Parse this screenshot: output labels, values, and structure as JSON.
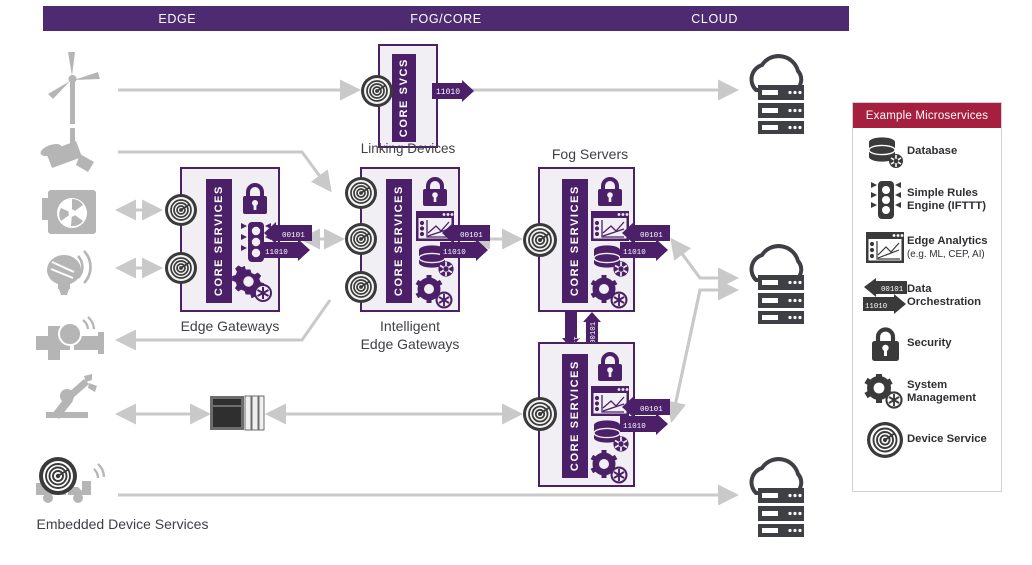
{
  "tiers": [
    {
      "label": "EDGE"
    },
    {
      "label": "FOG/CORE"
    },
    {
      "label": "CLOUD"
    }
  ],
  "colors": {
    "tier_bar": "#4e2a70",
    "box_border": "#4b2069",
    "box_fill": "#f1eff3",
    "core_bar": "#4b2069",
    "legend_header": "#a71f3e",
    "connector": "#c9c9c9",
    "device_icon": "#b0b0b0",
    "cloud_icon": "#3f3f46"
  },
  "boxes": {
    "linking_devices": {
      "caption": "Linking Devices",
      "core_label": "CORE SVCS",
      "device_services": 1,
      "microservices": []
    },
    "edge_gateways": {
      "caption": "Edge Gateways",
      "core_label": "CORE SERVICES",
      "device_services": 2,
      "microservices": [
        "security",
        "rules-engine",
        "system-management"
      ]
    },
    "intelligent_edge_gateways": {
      "caption_line1": "Intelligent",
      "caption_line2": "Edge Gateways",
      "core_label": "CORE SERVICES",
      "device_services": 3,
      "microservices": [
        "security",
        "edge-analytics",
        "database",
        "system-management"
      ]
    },
    "fog_servers": {
      "caption": "Fog Servers",
      "core_label": "CORE SERVICES",
      "device_services": 1,
      "microservices": [
        "security",
        "edge-analytics",
        "database",
        "system-management"
      ]
    },
    "fog_servers_lower": {
      "core_label": "CORE SERVICES",
      "device_services": 1,
      "microservices": [
        "security",
        "edge-analytics",
        "database",
        "system-management"
      ]
    }
  },
  "orchestration": {
    "inbound_bits": "00101",
    "outbound_bits": "11010",
    "top_bits": "11010",
    "up_bits": "00101",
    "down_bits": "11010"
  },
  "embedded_label": "Embedded Device Services",
  "devices": [
    {
      "name": "wind-turbine"
    },
    {
      "name": "security-camera"
    },
    {
      "name": "hvac-unit"
    },
    {
      "name": "smart-light"
    },
    {
      "name": "pipe-sensor"
    },
    {
      "name": "robotic-arm"
    },
    {
      "name": "connected-truck"
    },
    {
      "name": "plc-controller"
    }
  ],
  "clouds": [
    {
      "name": "cloud-server-top"
    },
    {
      "name": "cloud-server-middle"
    },
    {
      "name": "cloud-server-bottom"
    }
  ],
  "legend": {
    "title": "Example Microservices",
    "items": [
      {
        "icon": "database-icon",
        "label": "Database",
        "sub": ""
      },
      {
        "icon": "traffic-light-icon",
        "label": "Simple Rules\nEngine (IFTTT)",
        "sub": ""
      },
      {
        "icon": "edge-analytics-icon",
        "label": "Edge Analytics",
        "sub": "(e.g. ML, CEP, AI)"
      },
      {
        "icon": "data-orchestration-icon",
        "label": "Data\nOrchestration",
        "sub": ""
      },
      {
        "icon": "lock-icon",
        "label": "Security",
        "sub": ""
      },
      {
        "icon": "gear-icon",
        "label": "System\nManagement",
        "sub": ""
      },
      {
        "icon": "device-service-icon",
        "label": "Device Service",
        "sub": ""
      }
    ]
  }
}
